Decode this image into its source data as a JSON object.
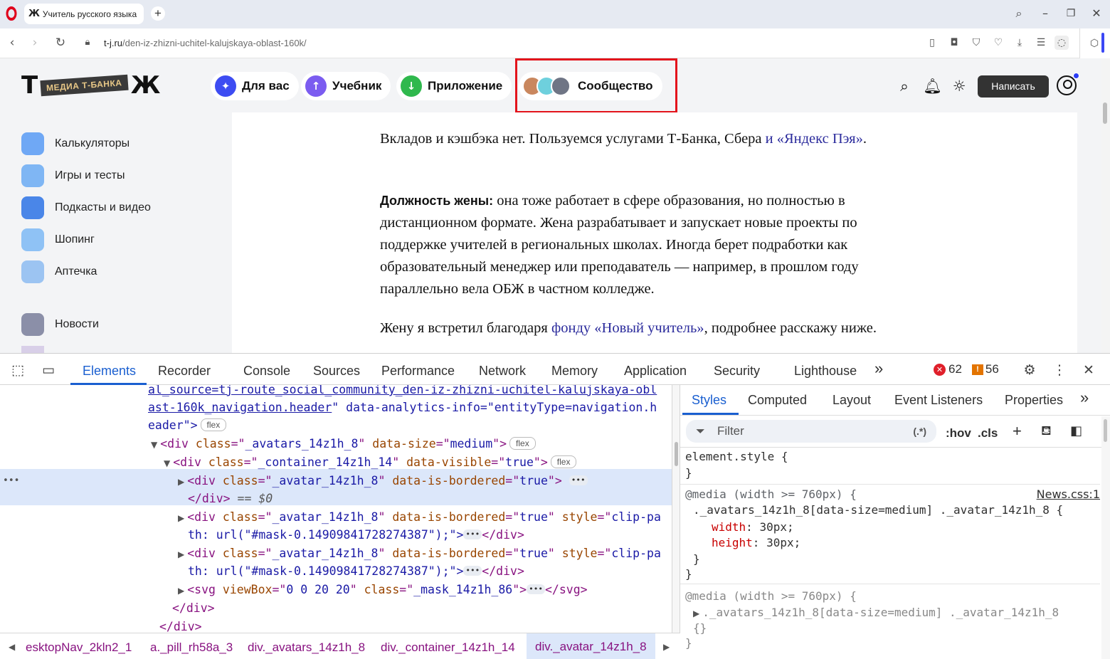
{
  "browser": {
    "tab_title": "Учитель русского языка",
    "tab_favicon": "Ж",
    "url_domain": "t-j.ru",
    "url_path": "/den-iz-zhizni-uchitel-kalujskaya-oblast-160k/"
  },
  "site": {
    "logo_left": "Т",
    "logo_band": "МЕДИА Т-БАНКА",
    "logo_right": "Ж",
    "nav": [
      {
        "label": "Для вас",
        "color": "#3d4cf2",
        "icon": "star-icon"
      },
      {
        "label": "Учебник",
        "color": "#7b5cf0",
        "icon": "upload-icon"
      },
      {
        "label": "Приложение",
        "color": "#2fb84d",
        "icon": "download-icon"
      },
      {
        "label": "Сообщество",
        "icon": "avatars-icon"
      }
    ],
    "write_button": "Написать",
    "sidebar": [
      {
        "label": "Калькуляторы",
        "color": "#6fa8f5"
      },
      {
        "label": "Игры и тесты",
        "color": "#7fb6f4"
      },
      {
        "label": "Подкасты и видео",
        "color": "#4a86e8"
      },
      {
        "label": "Шопинг",
        "color": "#8fc2f5"
      },
      {
        "label": "Аптечка",
        "color": "#9cc4f2"
      },
      {
        "label": "Новости",
        "color": "#8b8fa8"
      }
    ],
    "article": {
      "p1_text": "Вкладов и кэшбэка нет. Пользуемся услугами Т-Банка, Сбера ",
      "p1_link": "и «Яндекс Пэя»",
      "p1_end": ".",
      "p2_bold": "Должность жены:",
      "p2_text": " она тоже работает в сфере образования, но полностью в дистанционном формате. Жена разрабатывает и запускает новые проекты по поддержке учителей в региональных школах. Иногда берет подработки как образовательный менеджер или преподаватель — например, в прошлом году параллельно вела ОБЖ в частном колледже.",
      "p3_text": "Жену я встретил благодаря ",
      "p3_link": "фонду «Новый учитель»",
      "p3_end": ", подробнее расскажу ниже."
    }
  },
  "devtools": {
    "tabs": [
      "Elements",
      "Recorder",
      "Console",
      "Sources",
      "Performance",
      "Network",
      "Memory",
      "Application",
      "Security",
      "Lighthouse"
    ],
    "active_tab": "Elements",
    "more_tabs": "»",
    "error_count": "62",
    "warning_count": "56",
    "dom": {
      "l1": "al_source=tj-route_social_community_den-iz-zhizni-uchitel-kalujskaya-obl",
      "l2a": "ast-160k_navigation.header",
      "l2b": "\" data-analytics-info=\"entityType=navigation.h",
      "l3": "eader\">",
      "flex": "flex",
      "c1": "_avatars_14z1h_8",
      "ds": "medium",
      "c2": "_container_14z1h_14",
      "dv": "true",
      "c3": "_avatar_14z1h_8",
      "ib": "true",
      "eq": "== $0",
      "clip1": "clip-pa",
      "clip2": "th: url(\"#mask-0.14909841728274387\");\">",
      "vb": "0 0 20 20",
      "c4": "_mask_14z1h_86"
    },
    "breadcrumbs": [
      "esktopNav_2kln2_1",
      "a._pill_rh58a_3",
      "div._avatars_14z1h_8",
      "div._container_14z1h_14",
      "div._avatar_14z1h_8"
    ],
    "styles": {
      "tabs": [
        "Styles",
        "Computed",
        "Layout",
        "Event Listeners",
        "Properties"
      ],
      "filter_placeholder": "Filter",
      "filter_regex": "(.*)",
      "hov": ":hov",
      "cls": ".cls",
      "element_style": "element.style {",
      "close": "}",
      "media": "@media (width >= 760px) {",
      "source": "News.css:1",
      "selector": "._avatars_14z1h_8[data-size=medium] ._avatar_14z1h_8 {",
      "width_prop": "width",
      "width_val": "30px;",
      "height_prop": "height",
      "height_val": "30px;",
      "selector2": "._avatars_14z1h_8[data-size=medium] ._avatar_14z1h_8",
      "empty": "{}"
    }
  }
}
